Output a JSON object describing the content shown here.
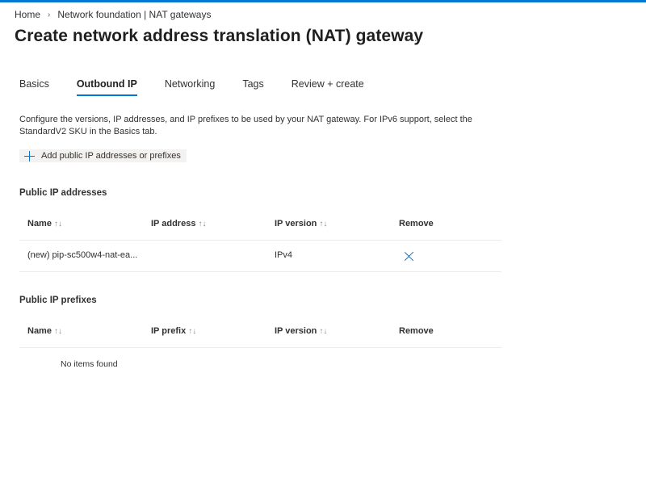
{
  "breadcrumb": {
    "home": "Home",
    "separator": "›",
    "parent": "Network foundation | NAT gateways"
  },
  "page_title": "Create network address translation (NAT) gateway",
  "more_label": "...",
  "tabs": [
    {
      "label": "Basics",
      "active": false
    },
    {
      "label": "Outbound IP",
      "active": true
    },
    {
      "label": "Networking",
      "active": false
    },
    {
      "label": "Tags",
      "active": false
    },
    {
      "label": "Review + create",
      "active": false
    }
  ],
  "description": "Configure the versions, IP addresses, and IP prefixes to be used by your NAT gateway. For IPv6 support, select the StandardV2 SKU in the Basics tab.",
  "add_button_label": "Add public IP addresses or prefixes",
  "public_ip_addresses": {
    "title": "Public IP addresses",
    "columns": [
      "Name",
      "IP address",
      "IP version",
      "Remove"
    ],
    "sort_glyph": "↑↓",
    "rows": [
      {
        "name": "(new) pip-sc500w4-nat-ea...",
        "ip_address": "",
        "ip_version": "IPv4"
      }
    ]
  },
  "public_ip_prefixes": {
    "title": "Public IP prefixes",
    "columns": [
      "Name",
      "IP prefix",
      "IP version",
      "Remove"
    ],
    "empty_text": "No items found"
  },
  "colors": {
    "accent": "#0078d4",
    "text": "#323130",
    "button_bg": "#f3f2f1",
    "divider": "#edebe9"
  }
}
